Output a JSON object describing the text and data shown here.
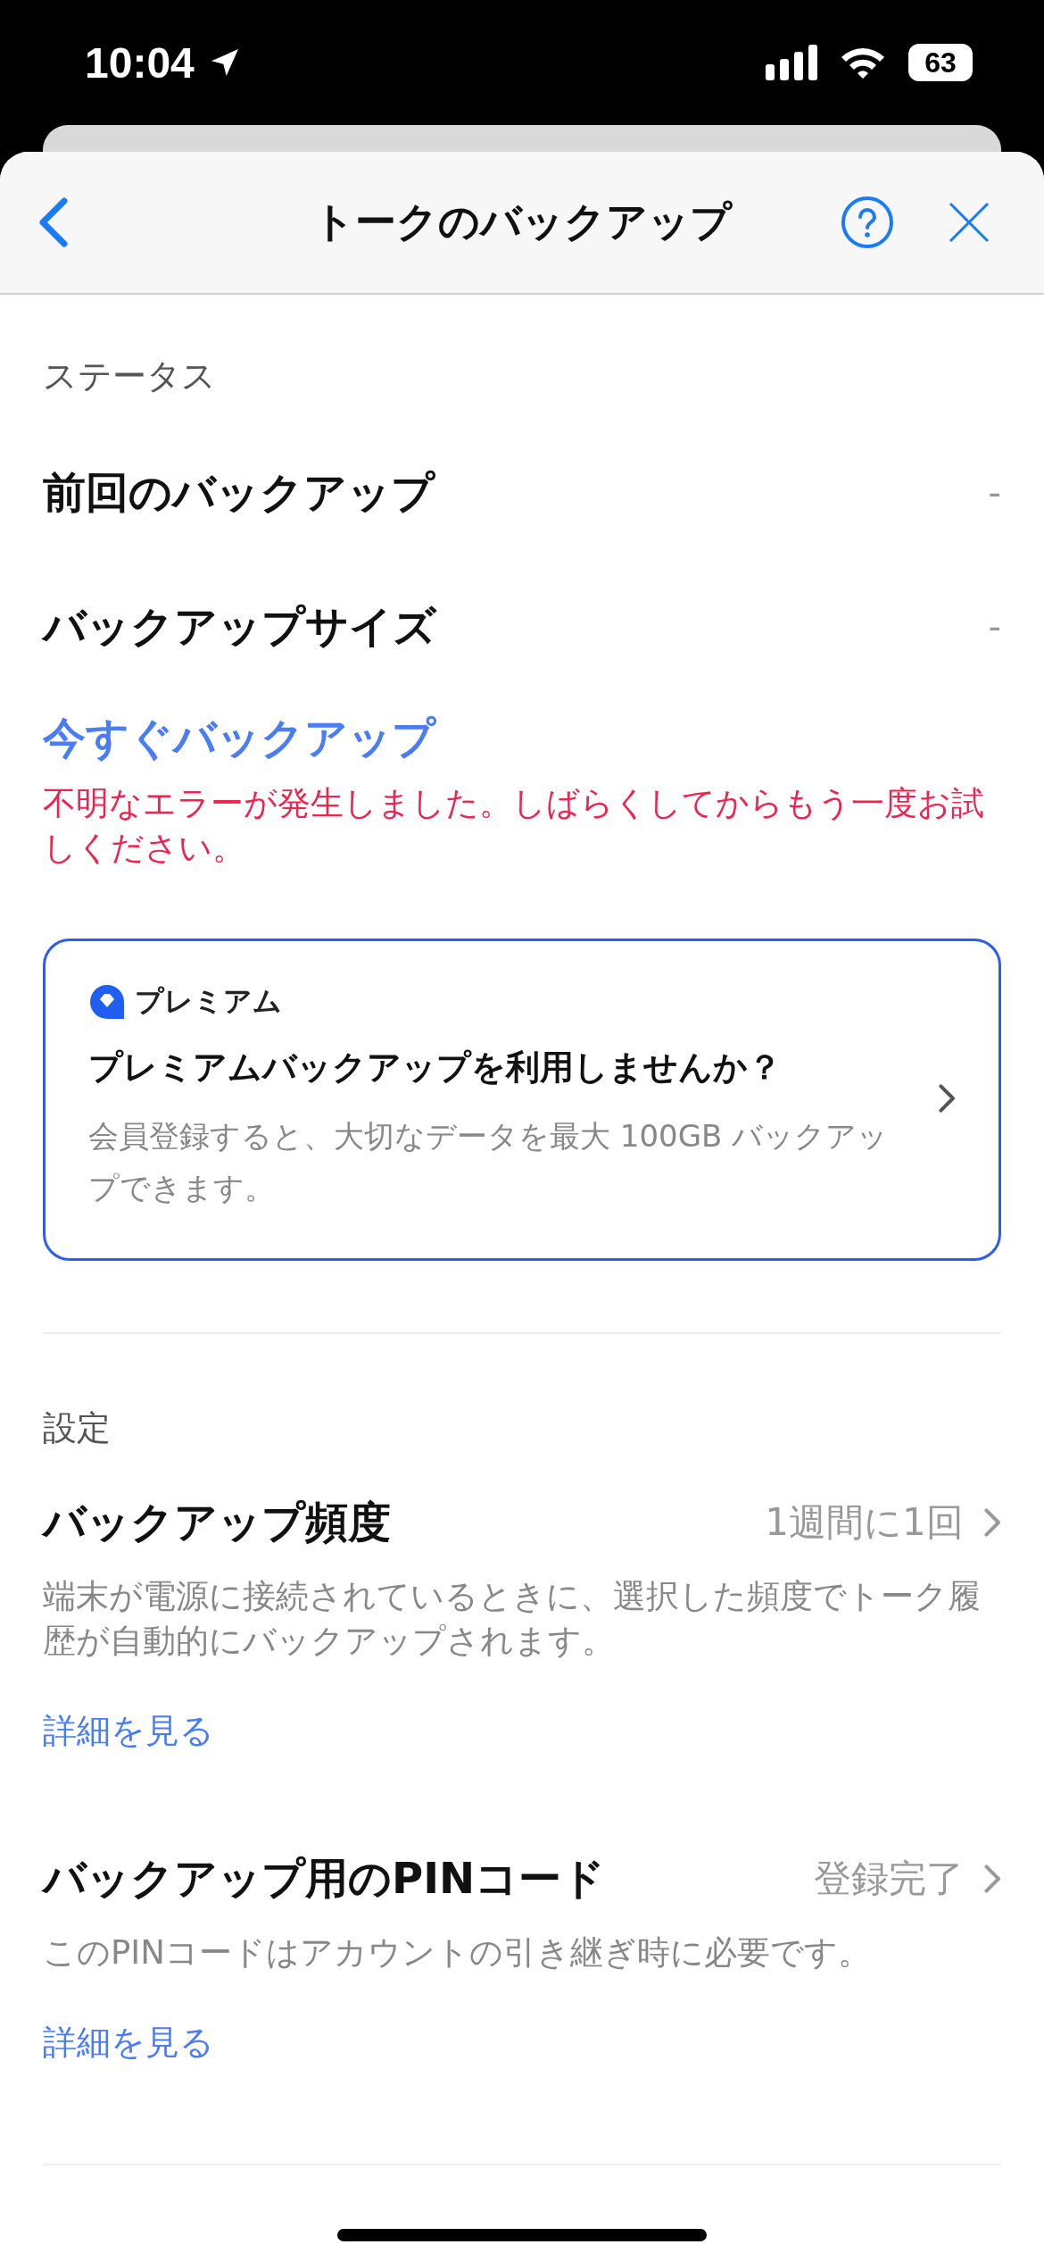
{
  "status_bar": {
    "time": "10:04",
    "battery": "63"
  },
  "header": {
    "title": "トークのバックアップ"
  },
  "status_section": {
    "heading": "ステータス",
    "rows": [
      {
        "label": "前回のバックアップ",
        "value": "-"
      },
      {
        "label": "バックアップサイズ",
        "value": "-"
      }
    ],
    "action": "今すぐバックアップ",
    "error": "不明なエラーが発生しました。しばらくしてからもう一度お試しください。"
  },
  "premium_card": {
    "badge": "プレミアム",
    "title": "プレミアムバックアップを利用しませんか？",
    "description": "会員登録すると、大切なデータを最大 100GB バックアップできます。"
  },
  "settings_section": {
    "heading": "設定",
    "items": [
      {
        "label": "バックアップ頻度",
        "value": "1週間に1回",
        "description": "端末が電源に接続されているときに、選択した頻度でトーク履歴が自動的にバックアップされます。",
        "link": "詳細を見る"
      },
      {
        "label": "バックアップ用のPINコード",
        "value": "登録完了",
        "description": "このPINコードはアカウントの引き継ぎ時に必要です。",
        "link": "詳細を見る"
      }
    ]
  }
}
